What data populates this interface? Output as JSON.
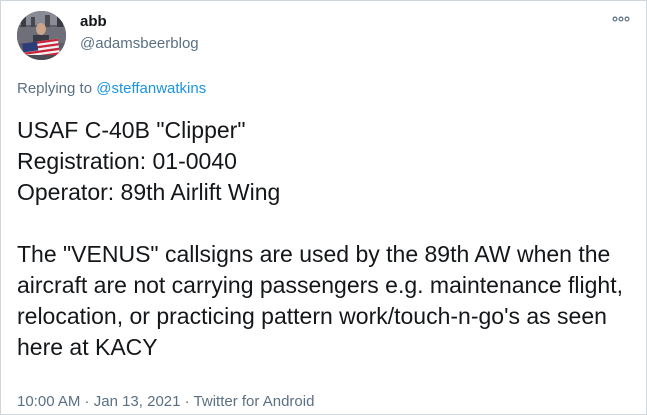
{
  "user": {
    "display_name": "abb",
    "handle": "@adamsbeerblog"
  },
  "reply": {
    "prefix": "Replying to ",
    "mention": "@steffanwatkins"
  },
  "tweet_text": "USAF C-40B \"Clipper\"\nRegistration: 01-0040\nOperator: 89th Airlift Wing\n\nThe \"VENUS\" callsigns are used by the 89th AW when the aircraft are not carrying passengers e.g. maintenance flight, relocation, or practicing pattern work/touch-n-go's as seen here at KACY",
  "meta": {
    "time": "10:00 AM",
    "sep1": " · ",
    "date": "Jan 13, 2021",
    "sep2": " · ",
    "source": "Twitter for Android"
  },
  "icons": {
    "menu": "more-options-icon",
    "avatar": "avatar-photo-flag"
  },
  "colors": {
    "text": "#14171a",
    "secondary": "#5b7083",
    "link": "#1b95e0",
    "border": "#d0d7dc"
  }
}
